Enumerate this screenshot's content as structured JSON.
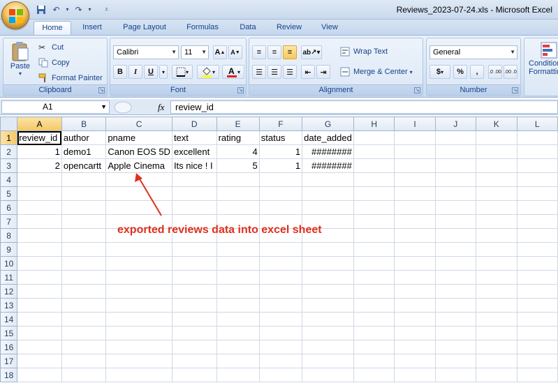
{
  "window": {
    "title": "Reviews_2023-07-24.xls - Microsoft Excel"
  },
  "tabs": [
    "Home",
    "Insert",
    "Page Layout",
    "Formulas",
    "Data",
    "Review",
    "View"
  ],
  "clipboard": {
    "paste": "Paste",
    "cut": "Cut",
    "copy": "Copy",
    "format_painter": "Format Painter",
    "label": "Clipboard"
  },
  "font": {
    "name": "Calibri",
    "size": "11",
    "label": "Font",
    "bold": "B",
    "italic": "I",
    "underline": "U"
  },
  "alignment": {
    "wrap": "Wrap Text",
    "merge": "Merge & Center",
    "label": "Alignment"
  },
  "number": {
    "format": "General",
    "currency": "$",
    "percent": "%",
    "comma": ",",
    "inc": ".0→.00",
    "dec": ".00→.0",
    "label": "Number"
  },
  "styles": {
    "conditional": "Conditional",
    "formatting": "Formatting"
  },
  "formula_bar": {
    "cell_ref": "A1",
    "fx": "fx",
    "value": "review_id"
  },
  "sheet": {
    "columns": [
      "A",
      "B",
      "C",
      "D",
      "E",
      "F",
      "G",
      "H",
      "I",
      "J",
      "K",
      "L"
    ],
    "rows": [
      [
        "review_id",
        "author",
        "pname",
        "text",
        "rating",
        "status",
        "date_added",
        "",
        "",
        "",
        "",
        ""
      ],
      [
        "1",
        "demo1",
        "Canon EOS 5D",
        "excellent",
        "4",
        "1",
        "########",
        "",
        "",
        "",
        "",
        ""
      ],
      [
        "2",
        "opencartt",
        "Apple Cinema",
        "Its nice ! I",
        "5",
        "1",
        "########",
        "",
        "",
        "",
        "",
        ""
      ],
      [
        "",
        "",
        "",
        "",
        "",
        "",
        "",
        "",
        "",
        "",
        "",
        ""
      ],
      [
        "",
        "",
        "",
        "",
        "",
        "",
        "",
        "",
        "",
        "",
        "",
        ""
      ],
      [
        "",
        "",
        "",
        "",
        "",
        "",
        "",
        "",
        "",
        "",
        "",
        ""
      ],
      [
        "",
        "",
        "",
        "",
        "",
        "",
        "",
        "",
        "",
        "",
        "",
        ""
      ],
      [
        "",
        "",
        "",
        "",
        "",
        "",
        "",
        "",
        "",
        "",
        "",
        ""
      ],
      [
        "",
        "",
        "",
        "",
        "",
        "",
        "",
        "",
        "",
        "",
        "",
        ""
      ],
      [
        "",
        "",
        "",
        "",
        "",
        "",
        "",
        "",
        "",
        "",
        "",
        ""
      ],
      [
        "",
        "",
        "",
        "",
        "",
        "",
        "",
        "",
        "",
        "",
        "",
        ""
      ],
      [
        "",
        "",
        "",
        "",
        "",
        "",
        "",
        "",
        "",
        "",
        "",
        ""
      ],
      [
        "",
        "",
        "",
        "",
        "",
        "",
        "",
        "",
        "",
        "",
        "",
        ""
      ],
      [
        "",
        "",
        "",
        "",
        "",
        "",
        "",
        "",
        "",
        "",
        "",
        ""
      ],
      [
        "",
        "",
        "",
        "",
        "",
        "",
        "",
        "",
        "",
        "",
        "",
        ""
      ],
      [
        "",
        "",
        "",
        "",
        "",
        "",
        "",
        "",
        "",
        "",
        "",
        ""
      ],
      [
        "",
        "",
        "",
        "",
        "",
        "",
        "",
        "",
        "",
        "",
        "",
        ""
      ],
      [
        "",
        "",
        "",
        "",
        "",
        "",
        "",
        "",
        "",
        "",
        "",
        ""
      ]
    ]
  },
  "annotation": {
    "text": "exported reviews data into excel sheet",
    "color": "#e0301e"
  }
}
